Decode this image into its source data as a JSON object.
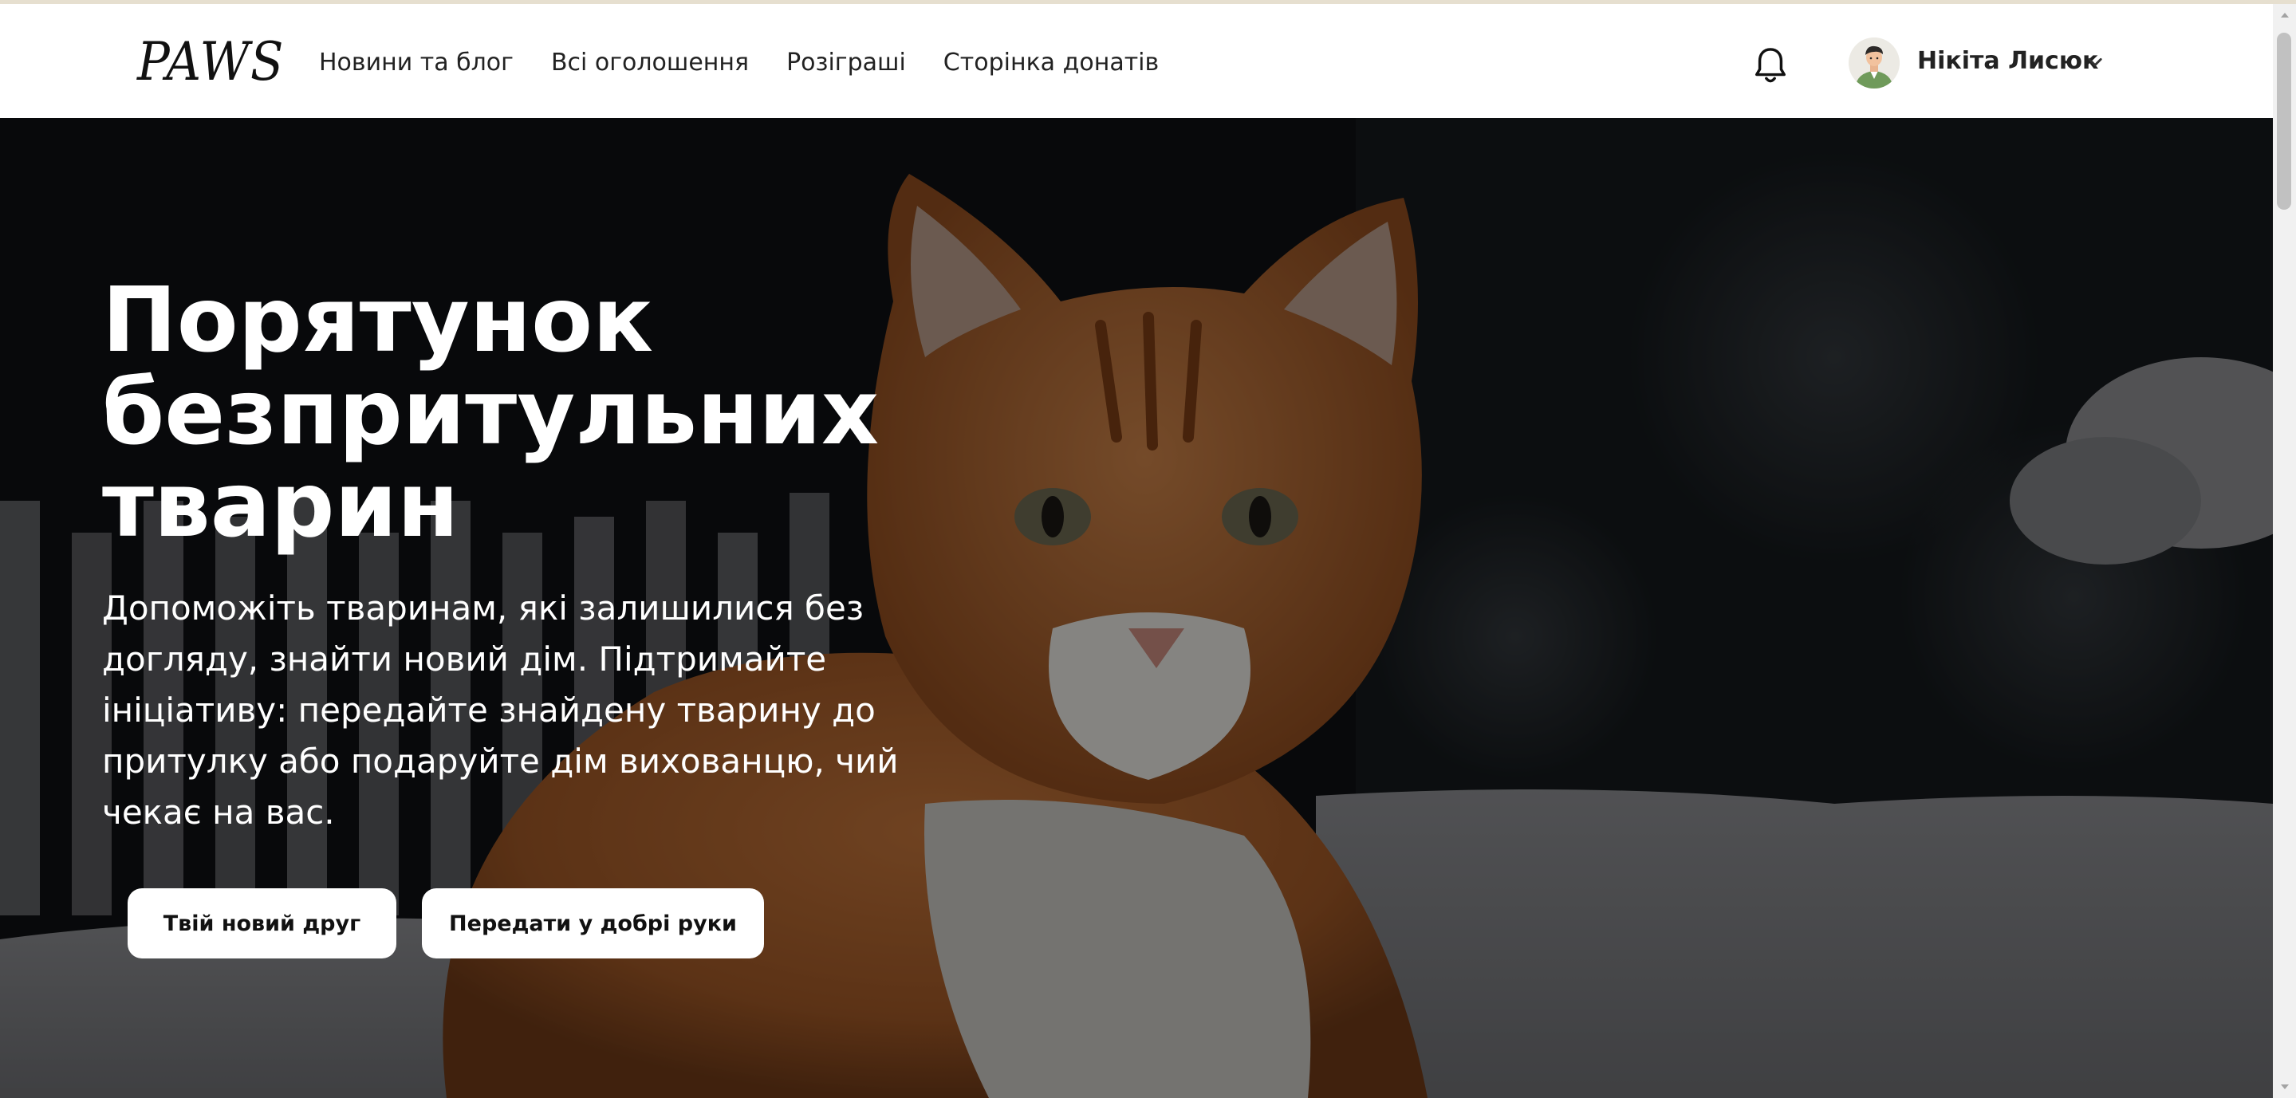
{
  "header": {
    "logo": "PAWS",
    "nav": [
      {
        "label": "Новини та блог"
      },
      {
        "label": "Всі оголошення"
      },
      {
        "label": "Розіграші"
      },
      {
        "label": "Сторінка донатів"
      }
    ],
    "user": {
      "name": "Нікіта Лисюк"
    },
    "icons": {
      "notifications": "bell-icon",
      "user_menu": "chevron-down-icon"
    }
  },
  "hero": {
    "title": "Порятунок безпритульних тварин",
    "description": "Допоможіть тваринам, які залишилися без догляду, знайти новий дім. Підтримайте ініціативу: передайте знайдену тварину до притулку або подаруйте дім вихованцю, чий чекає на вас.",
    "buttons": [
      {
        "label": "Твій новий друг"
      },
      {
        "label": "Передати у добрі руки"
      }
    ],
    "image": "ginger-and-white-cat-in-snow"
  },
  "colors": {
    "header_bg": "#ffffff",
    "text_dark": "#222222",
    "hero_text": "#ffffff",
    "button_bg": "#ffffff",
    "cat_orange": "#b8692f"
  }
}
